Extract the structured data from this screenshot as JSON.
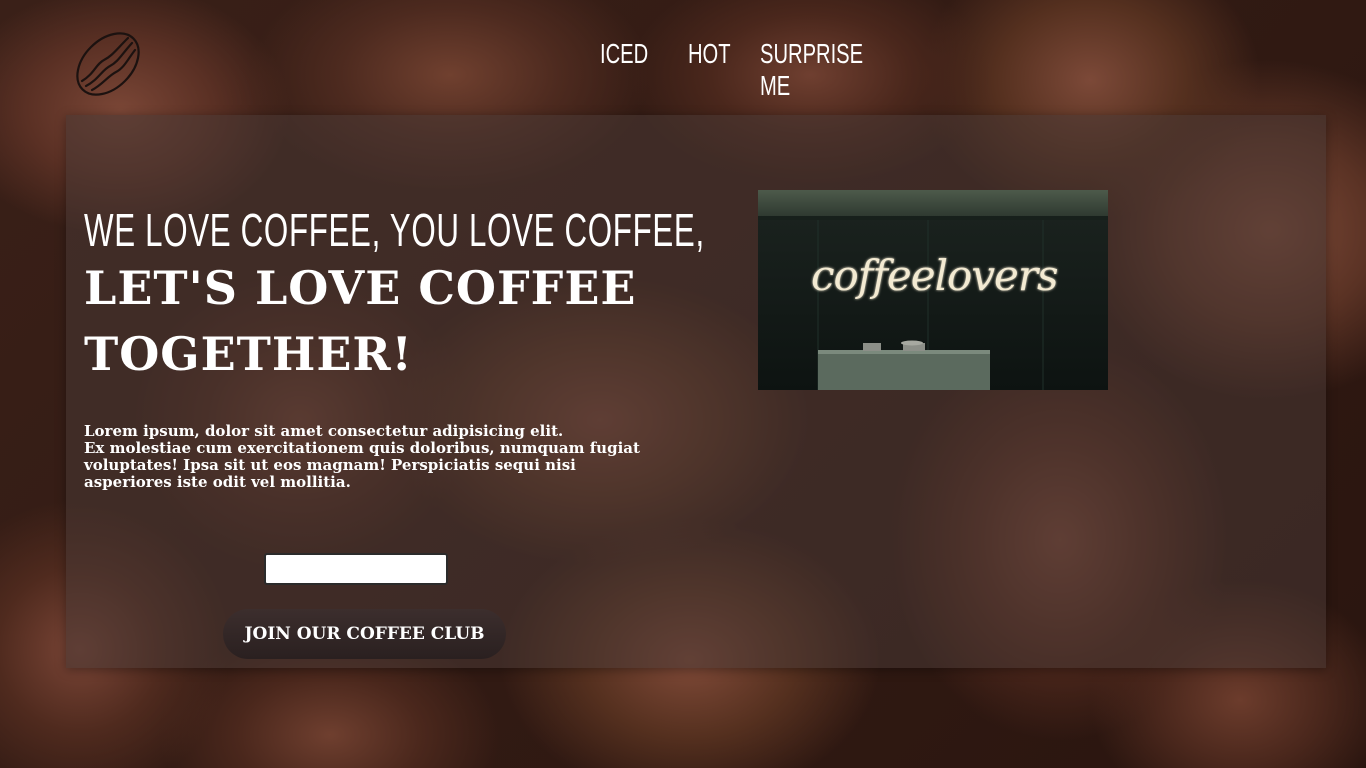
{
  "header": {
    "logo": {
      "icon": "coffee-bean-icon"
    },
    "nav": [
      {
        "label": "ICED"
      },
      {
        "label": "HOT"
      },
      {
        "label": "SURPRISE ME"
      }
    ]
  },
  "hero": {
    "tagline": "WE LOVE COFFEE, YOU LOVE COFFEE,",
    "headline": "LET'S LOVE COFFEE TOGETHER!",
    "body_lines": [
      "Lorem ipsum, dolor sit amet consectetur adipisicing elit.",
      "Ex molestiae cum exercitationem quis doloribus, numquam fugiat voluptates! Ipsa sit ut eos magnam! Perspiciatis sequi nisi asperiores iste odit vel mollitia."
    ],
    "email": {
      "value": "",
      "placeholder": ""
    },
    "cta_label": "JOIN OUR COFFEE CLUB"
  },
  "photo": {
    "sign_text": "coffeelovers"
  },
  "colors": {
    "card_overlay": "#48383",
    "button_bg": "#332626",
    "text": "#ffffff",
    "neon": "#f3ead2"
  }
}
